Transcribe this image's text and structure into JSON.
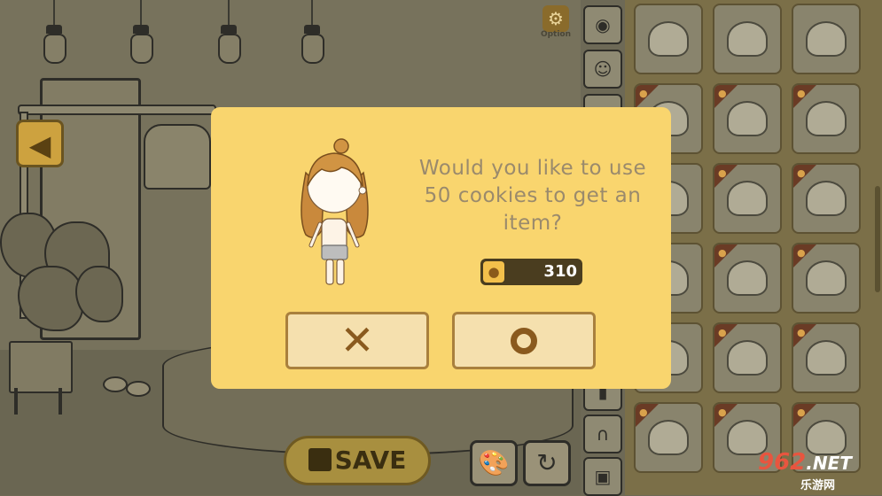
{
  "top_bar": {
    "option_label": "Option"
  },
  "bottom_bar": {
    "save_label": "SAVE"
  },
  "dialog": {
    "question": "Would you like to use 50 cookies to get an item?",
    "cookie_balance": "310",
    "cancel_symbol": "✕",
    "confirm_symbol": "O"
  },
  "watermark": {
    "logo_text": "962",
    "logo_suffix": ".NET",
    "subtitle": "乐游网"
  },
  "icons": {
    "back": "arrow-left-icon",
    "option": "gear-icon",
    "save": "floppy-disk-icon",
    "palette": "palette-icon",
    "refresh": "refresh-icon",
    "cookie": "gingerbread-cookie-icon"
  },
  "colors": {
    "dialog_bg": "#f9d56e",
    "button_bg": "#f5e0ae",
    "button_border": "#a9803d",
    "question_text": "#9a8a6c",
    "counter_bg": "#4a3d1f"
  }
}
